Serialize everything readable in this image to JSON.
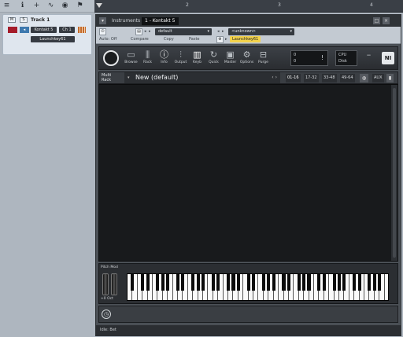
{
  "left_toolbar": {
    "icons": [
      "list-icon",
      "info-icon",
      "add-icon",
      "automation-icon",
      "globe-icon",
      "flag-icon"
    ]
  },
  "track": {
    "mute": "M",
    "solo": "S",
    "name": "Track 1",
    "instrument": "Kontakt 5",
    "channel": "Ch 1",
    "input": "Launchkey61"
  },
  "timeline": {
    "ticks": [
      "2",
      "3",
      "4"
    ]
  },
  "plugin_window": {
    "tabs": [
      "Instruments",
      "1 - Kontakt 5"
    ],
    "preset": "default",
    "routing": "<unknown>",
    "auto_off": "Auto: Off",
    "compare": "Compare",
    "copy": "Copy",
    "paste": "Paste",
    "input_chip": "Launchkey61",
    "kontakt": {
      "buttons": [
        "Browse",
        "Rack",
        "Info",
        "Output",
        "Keyb",
        "Quick",
        "Master",
        "Options",
        "Purge"
      ],
      "cpu_label": "CPU",
      "disk_label": "Disk",
      "voices_a": "0",
      "voices_b": "0",
      "multi_label": "Multi\nRack",
      "multi_name": "New (default)",
      "ranges": [
        "01-16",
        "17-32",
        "33-48",
        "49-64"
      ],
      "aux": "AUX",
      "octave": "+0 Oct",
      "pitch_mod": "Pitch Mod",
      "footer": "Idle: Bet"
    }
  }
}
